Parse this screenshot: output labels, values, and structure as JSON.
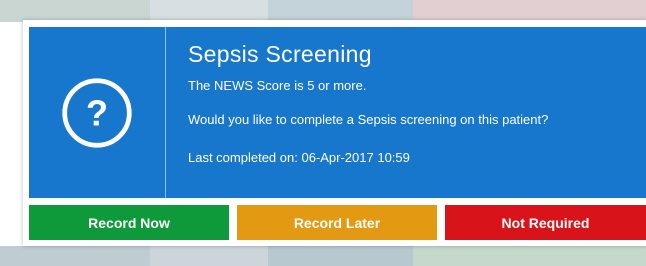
{
  "dialog": {
    "title": "Sepsis Screening",
    "message_1": "The NEWS Score is 5 or more.",
    "message_2": "Would you like to complete a Sepsis screening on this patient?",
    "last_completed": "Last completed on: 06-Apr-2017 10:59",
    "icon": "question-circle-icon"
  },
  "buttons": {
    "record_now": "Record Now",
    "record_later": "Record Later",
    "not_required": "Not Required"
  },
  "colors": {
    "dialog_bg": "#1777cc",
    "record_now": "#0e9a3a",
    "record_later": "#e39a12",
    "not_required": "#d8141a"
  }
}
